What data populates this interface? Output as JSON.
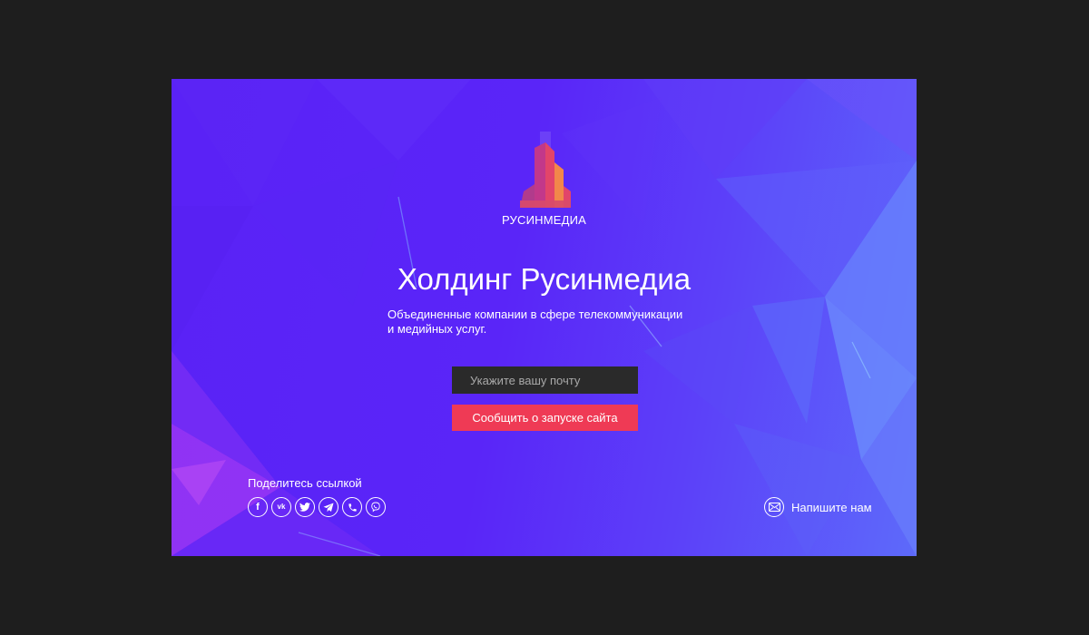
{
  "colors": {
    "frame": "#1e1e1e",
    "background": "#5a24f7",
    "input_bg": "#2a2a2a",
    "accent_button": "#ef3a55",
    "logo_pink": "#e2456a",
    "logo_orange": "#f2874a"
  },
  "logo": {
    "icon": "building-logo-icon",
    "brand": "РУСИНМЕДИА"
  },
  "hero": {
    "title": "Холдинг Русинмедиа",
    "subtitle_line1": "Объединенные компании в сфере телекоммуникации",
    "subtitle_line2": "и медийных услуг."
  },
  "form": {
    "email_placeholder": "Укажите вашу почту",
    "email_value": "",
    "submit_label": "Сообщить о запуске сайта"
  },
  "share": {
    "label": "Поделитесь ссылкой",
    "items": [
      {
        "icon": "facebook-icon",
        "glyph": "f"
      },
      {
        "icon": "vk-icon",
        "glyph": "vk"
      },
      {
        "icon": "twitter-icon"
      },
      {
        "icon": "telegram-icon"
      },
      {
        "icon": "phone-icon"
      },
      {
        "icon": "viber-icon"
      }
    ]
  },
  "contact": {
    "icon": "mail-icon",
    "label": "Напишите нам"
  }
}
